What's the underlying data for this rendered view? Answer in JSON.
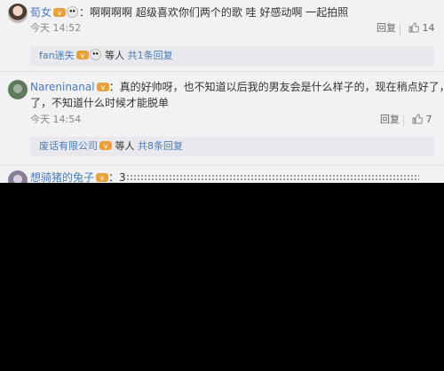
{
  "comments": [
    {
      "username": "荀女",
      "separator": "：",
      "text": "啊啊啊啊 超级喜欢你们两个的歌 哇 好感动啊 一起拍照",
      "time": "今天 14:52",
      "reply_label": "回复",
      "likes": "14",
      "sub": {
        "user": "fan迷失",
        "middle": "等人",
        "link": "共1条回复"
      }
    },
    {
      "username": "Nareninanal",
      "separator": "：",
      "text_line1": "真的好帅呀，也不知道以后我的男友会是什么样子的，现在稍点好了，也漂亮",
      "text_line2": "了，不知道什么时候才能脱单",
      "time": "今天 14:54",
      "reply_label": "回复",
      "likes": "7",
      "sub": {
        "user": "废话有限公司",
        "middle": "等人",
        "link": "共8条回复"
      }
    },
    {
      "username": "想骑猪的兔子",
      "separator": "：",
      "text": "3"
    }
  ],
  "icons": {
    "badge": "vip-badge-icon",
    "emoji": "panda-emoji-icon",
    "thumb": "thumb-up-icon"
  },
  "colors": {
    "username": "#4a7bb5",
    "panel": "#f2f2f5",
    "badge": "#e8a23a"
  }
}
